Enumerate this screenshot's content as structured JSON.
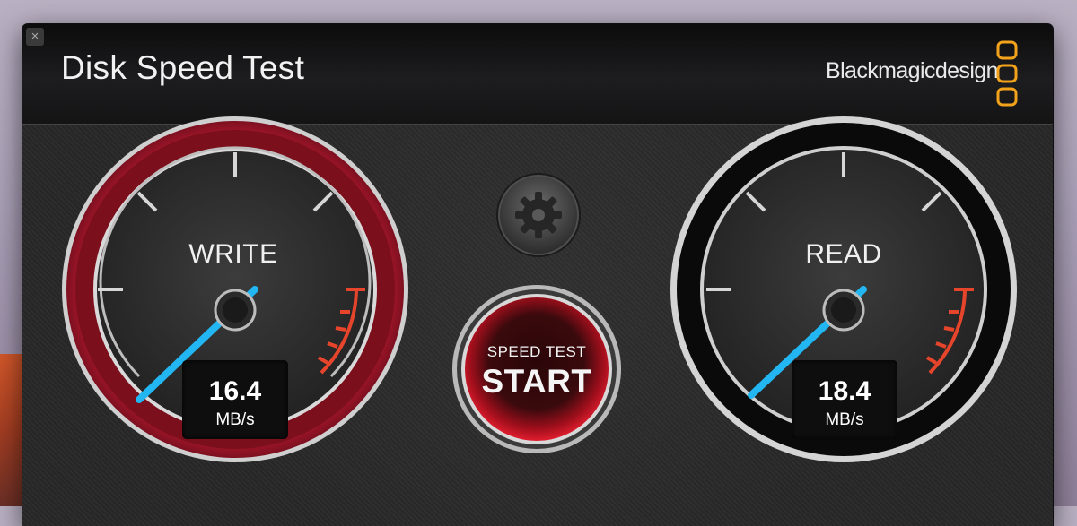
{
  "window": {
    "title": "Disk Speed Test",
    "close_icon": "×",
    "brand": "Blackmagicdesign"
  },
  "gauges": [
    {
      "label": "WRITE",
      "value": "16.4",
      "unit": "MB/s",
      "accent": "#c8102e"
    },
    {
      "label": "READ",
      "value": "18.4",
      "unit": "MB/s",
      "accent": "#6a6a6a"
    }
  ],
  "buttons": {
    "settings_icon": "gear-icon",
    "start_small": "SPEED TEST",
    "start_big": "START"
  },
  "colors": {
    "needle": "#22b7f2",
    "redline": "#e7452b",
    "brand_orange": "#f3a21b"
  }
}
